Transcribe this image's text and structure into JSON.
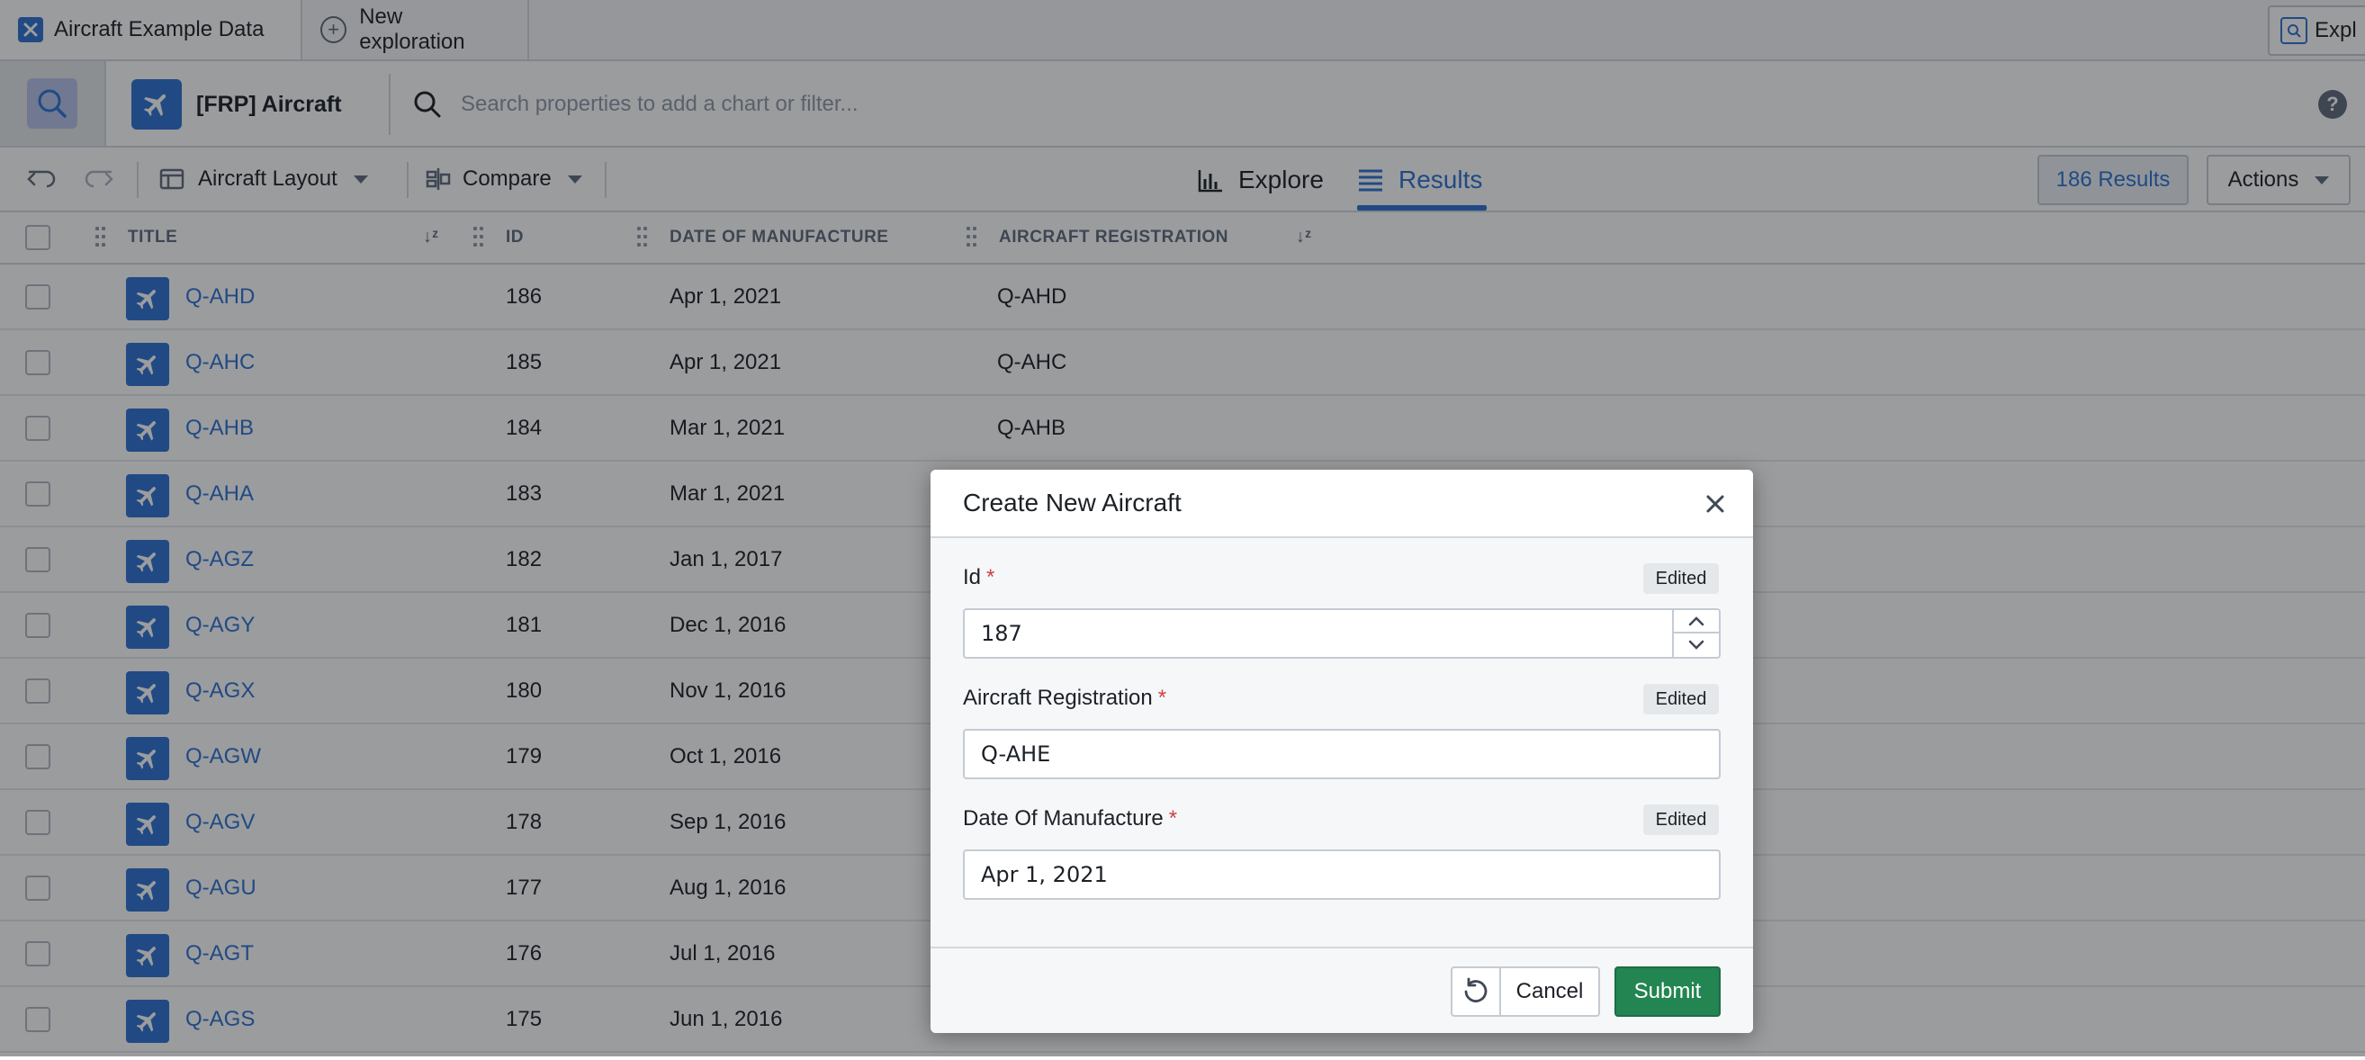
{
  "tabs": [
    {
      "label": "Aircraft Example Data",
      "icon": "object-icon"
    },
    {
      "label": "New exploration",
      "icon": "plus-circle-icon"
    }
  ],
  "tab_right_label": "Expl",
  "object_type": {
    "label": "[FRP] Aircraft",
    "icon": "airplane-icon"
  },
  "search": {
    "placeholder": "Search properties to add a chart or filter..."
  },
  "help_label": "?",
  "toolbar": {
    "layout_label": "Aircraft Layout",
    "compare_label": "Compare",
    "explore_label": "Explore",
    "results_label": "Results",
    "count_label": "186 Results",
    "actions_label": "Actions"
  },
  "table": {
    "headers": [
      "TITLE",
      "ID",
      "DATE OF MANUFACTURE",
      "AIRCRAFT REGISTRATION"
    ],
    "rows": [
      {
        "title": "Q-AHD",
        "id": "186",
        "date": "Apr 1, 2021",
        "reg": "Q-AHD"
      },
      {
        "title": "Q-AHC",
        "id": "185",
        "date": "Apr 1, 2021",
        "reg": "Q-AHC"
      },
      {
        "title": "Q-AHB",
        "id": "184",
        "date": "Mar 1, 2021",
        "reg": "Q-AHB"
      },
      {
        "title": "Q-AHA",
        "id": "183",
        "date": "Mar 1, 2021",
        "reg": ""
      },
      {
        "title": "Q-AGZ",
        "id": "182",
        "date": "Jan 1, 2017",
        "reg": ""
      },
      {
        "title": "Q-AGY",
        "id": "181",
        "date": "Dec 1, 2016",
        "reg": ""
      },
      {
        "title": "Q-AGX",
        "id": "180",
        "date": "Nov 1, 2016",
        "reg": ""
      },
      {
        "title": "Q-AGW",
        "id": "179",
        "date": "Oct 1, 2016",
        "reg": ""
      },
      {
        "title": "Q-AGV",
        "id": "178",
        "date": "Sep 1, 2016",
        "reg": ""
      },
      {
        "title": "Q-AGU",
        "id": "177",
        "date": "Aug 1, 2016",
        "reg": ""
      },
      {
        "title": "Q-AGT",
        "id": "176",
        "date": "Jul 1, 2016",
        "reg": ""
      },
      {
        "title": "Q-AGS",
        "id": "175",
        "date": "Jun 1, 2016",
        "reg": ""
      }
    ]
  },
  "dialog": {
    "title": "Create New Aircraft",
    "fields": [
      {
        "label": "Id",
        "required": "*",
        "badge": "Edited",
        "value": "187"
      },
      {
        "label": "Aircraft Registration",
        "required": "*",
        "badge": "Edited",
        "value": "Q-AHE"
      },
      {
        "label": "Date Of Manufacture",
        "required": "*",
        "badge": "Edited",
        "value": "Apr 1, 2021"
      }
    ],
    "cancel_label": "Cancel",
    "submit_label": "Submit"
  },
  "colors": {
    "accent": "#2d72d2",
    "submit": "#238551",
    "required": "#cd4246"
  }
}
